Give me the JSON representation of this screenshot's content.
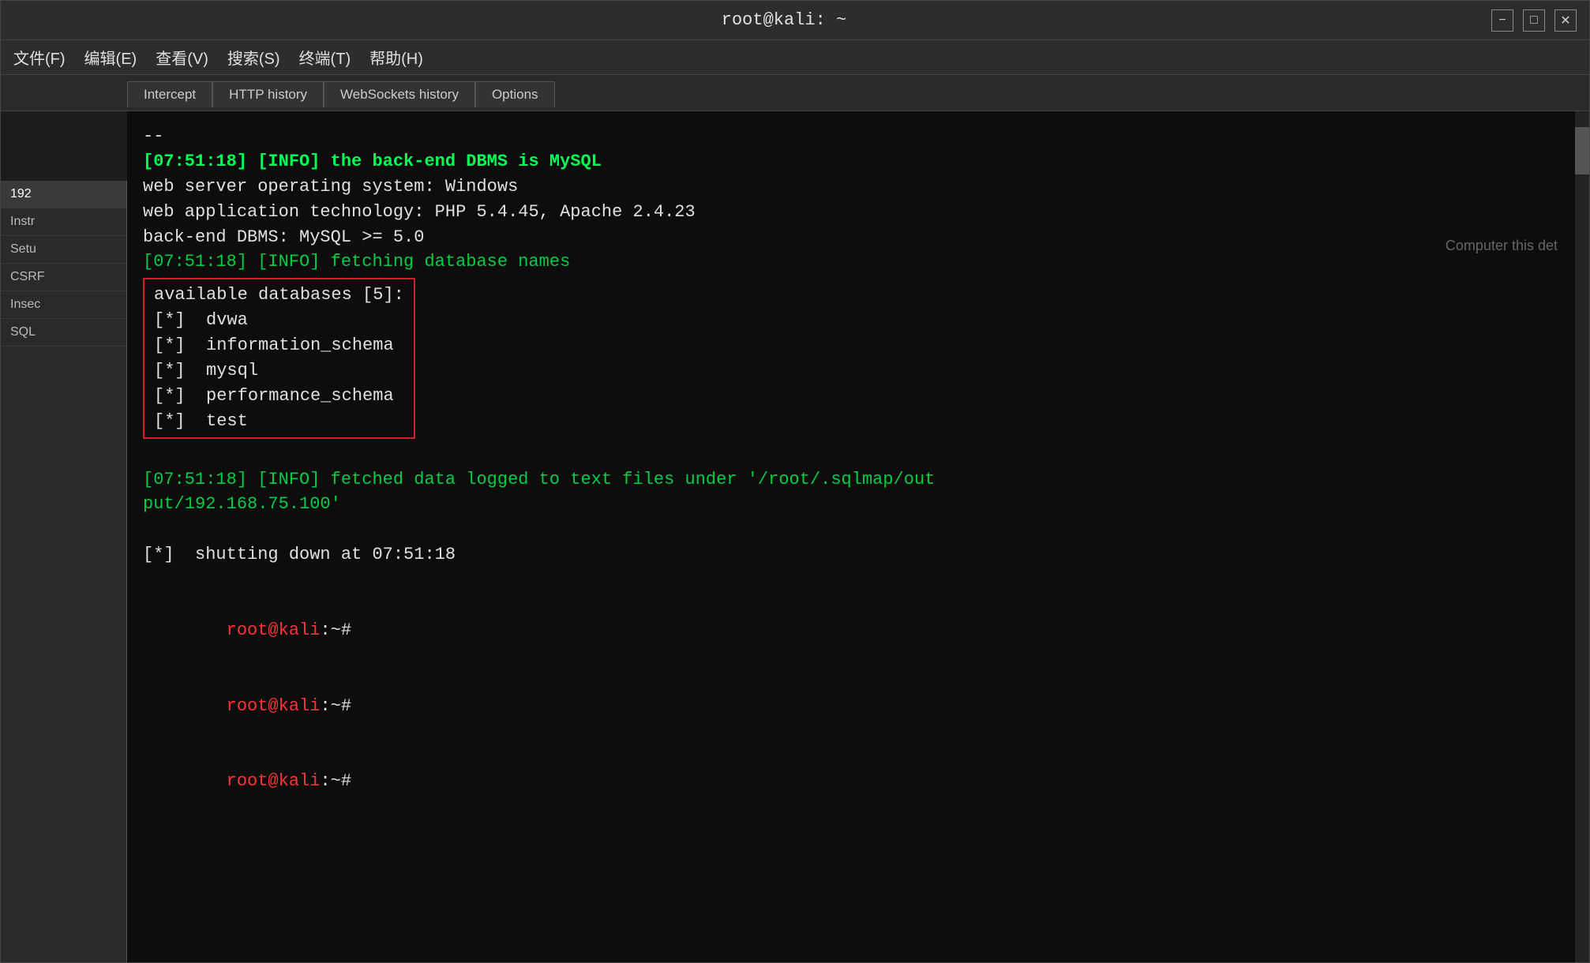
{
  "window": {
    "title": "root@kali: ~",
    "minimize_label": "−",
    "maximize_label": "□",
    "close_label": "✕"
  },
  "menubar": {
    "items": [
      {
        "label": "文件(F)"
      },
      {
        "label": "编辑(E)"
      },
      {
        "label": "查看(V)"
      },
      {
        "label": "搜索(S)"
      },
      {
        "label": "终端(T)"
      },
      {
        "label": "帮助(H)"
      }
    ]
  },
  "tabs": [
    {
      "label": "Intercept",
      "active": false
    },
    {
      "label": "HTTP history",
      "active": false
    },
    {
      "label": "WebSockets history",
      "active": false
    },
    {
      "label": "Options",
      "active": false
    }
  ],
  "terminal": {
    "lines": [
      {
        "text": "--",
        "color": "white"
      },
      {
        "text": "[07:51:18] [INFO] the back-end DBMS is MySQL",
        "color": "bright-green",
        "bold": true
      },
      {
        "text": "web server operating system: Windows",
        "color": "white"
      },
      {
        "text": "web application technology: PHP 5.4.45, Apache 2.4.23",
        "color": "white"
      },
      {
        "text": "back-end DBMS: MySQL >= 5.0",
        "color": "white"
      },
      {
        "text": "[07:51:18] [INFO] fetching database names",
        "color": "green"
      }
    ],
    "db_list": {
      "header": "available databases [5]:",
      "items": [
        "[*] dvwa",
        "[*] information_schema",
        "[*] mysql",
        "[*] performance_schema",
        "[*] test"
      ]
    },
    "footer_lines": [
      {
        "text": "[07:51:18] [INFO] fetched data logged to text files under '/root/.sqlmap/output/192.168.75.100'",
        "color": "green"
      },
      {
        "text": "",
        "color": "white"
      },
      {
        "text": "[*] shutting down at 07:51:18",
        "color": "white"
      }
    ],
    "prompts": [
      {
        "text": "root@kali:~#",
        "color": "red"
      },
      {
        "text": "root@kali:~#",
        "color": "red"
      },
      {
        "text": "root@kali:~#",
        "color": "red"
      }
    ]
  },
  "left_panel": {
    "items": [
      {
        "label": "192",
        "selected": true
      },
      {
        "label": "Instr"
      },
      {
        "label": "Setu"
      },
      {
        "label": "CSRF"
      },
      {
        "label": "Insec"
      },
      {
        "label": "SQL"
      }
    ]
  }
}
